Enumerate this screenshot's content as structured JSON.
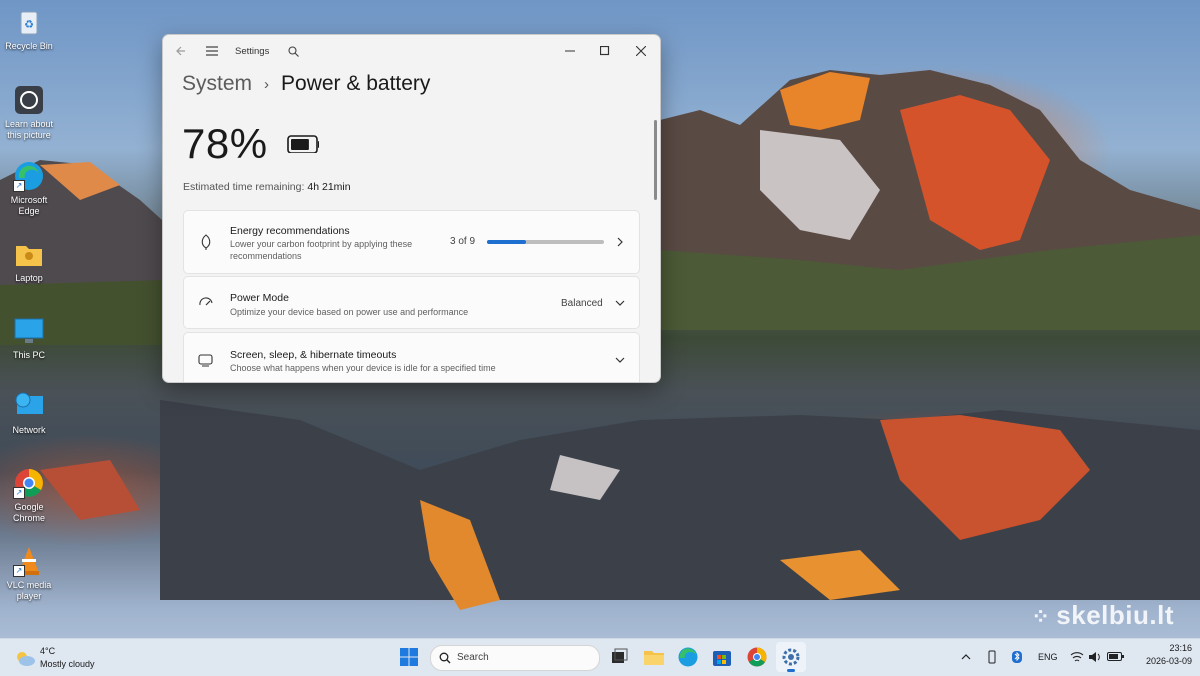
{
  "desktop": {
    "icons": [
      {
        "label": "Recycle Bin",
        "icon": "recycle-bin-icon"
      },
      {
        "label": "Learn about\nthis picture",
        "icon": "camera-info-icon"
      },
      {
        "label": "Microsoft\nEdge",
        "icon": "edge-icon"
      },
      {
        "label": "Laptop",
        "icon": "user-folder-icon"
      },
      {
        "label": "This PC",
        "icon": "monitor-icon"
      },
      {
        "label": "Network",
        "icon": "network-globe-icon"
      },
      {
        "label": "Google\nChrome",
        "icon": "chrome-icon"
      },
      {
        "label": "VLC media\nplayer",
        "icon": "vlc-cone-icon"
      }
    ],
    "watermark": "skelbiu.lt"
  },
  "window": {
    "title": "Settings",
    "breadcrumb_parent": "System",
    "breadcrumb_sep": "›",
    "page_title": "Power & battery",
    "battery_percent": "78%",
    "battery_level": 0.78,
    "estimate_label": "Estimated time remaining:",
    "estimate_value": "4h 21min",
    "energy": {
      "title": "Energy recommendations",
      "subtitle_line1": "Lower your carbon footprint by applying these",
      "subtitle_line2": "recommendations",
      "progress_text": "3 of 9",
      "progress_fraction": 0.333
    },
    "power_mode": {
      "title": "Power Mode",
      "subtitle": "Optimize your device based on power use and performance",
      "value": "Balanced"
    },
    "timeouts": {
      "title": "Screen, sleep, & hibernate timeouts",
      "subtitle": "Choose what happens when your device is idle for a specified time"
    }
  },
  "taskbar": {
    "weather_temp": "4°C",
    "weather_desc": "Mostly cloudy",
    "search_placeholder": "Search",
    "language": "ENG",
    "time": "23:16",
    "date": "2026-03-09"
  },
  "colors": {
    "accent": "#1f6fd1",
    "window_bg": "#f3f3f3",
    "taskbar_bg": "#dfe7f1"
  }
}
